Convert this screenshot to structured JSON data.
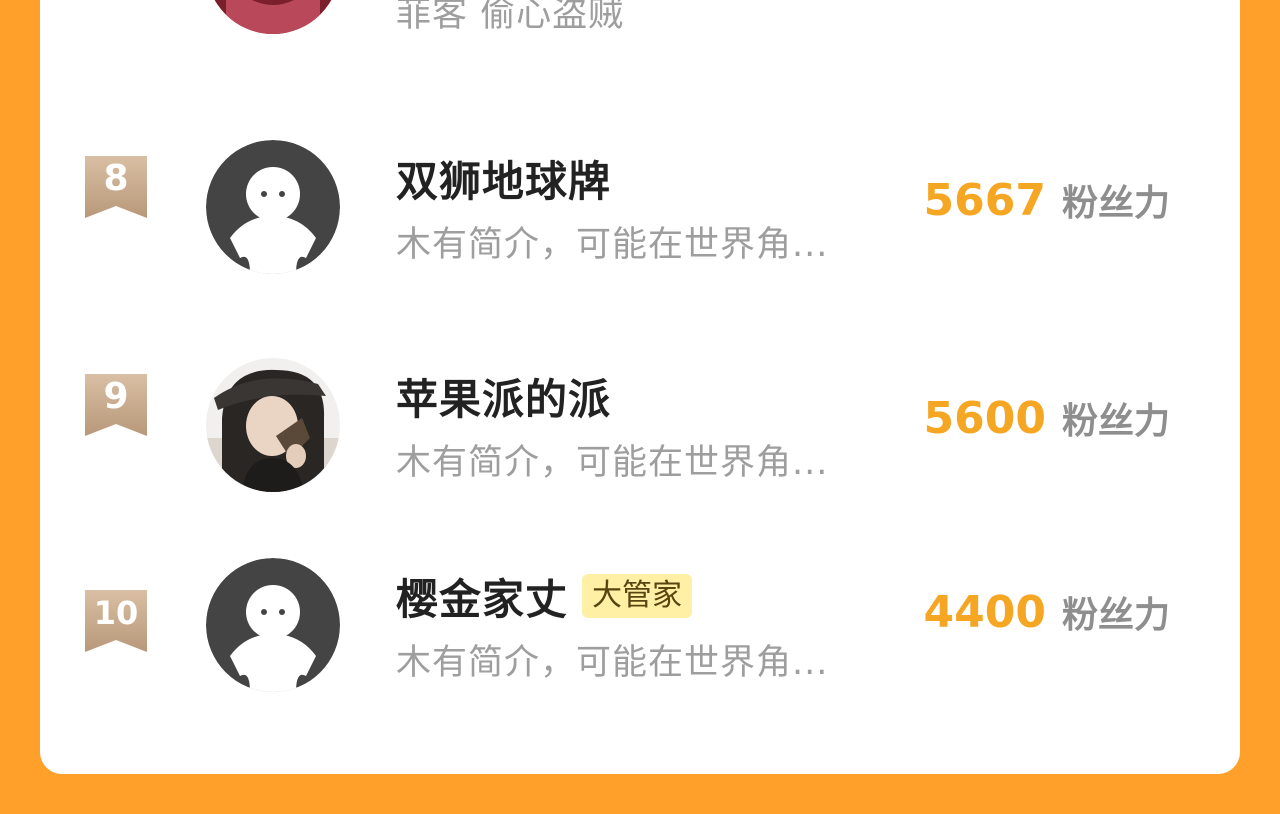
{
  "partial_top_entry": {
    "desc": "菲客 偷心盗贼"
  },
  "entries": [
    {
      "rank": "8",
      "name": "双狮地球牌",
      "desc": "木有简介，可能在世界角...",
      "score": "5667",
      "score_unit": "粉丝力",
      "avatar": "default-avatar"
    },
    {
      "rank": "9",
      "name": "苹果派的派",
      "desc": "木有简介，可能在世界角...",
      "score": "5600",
      "score_unit": "粉丝力",
      "avatar": "photo-avatar"
    },
    {
      "rank": "10",
      "name": "樱金家丈",
      "badge": "大管家",
      "desc": "木有简介，可能在世界角...",
      "score": "4400",
      "score_unit": "粉丝力",
      "avatar": "default-avatar"
    }
  ],
  "colors": {
    "background": "#FFA02A",
    "card": "#FFFFFF",
    "score": "#F5A623",
    "rank_ribbon": "#C9A98B",
    "badge_bg": "#FFF0A6"
  }
}
